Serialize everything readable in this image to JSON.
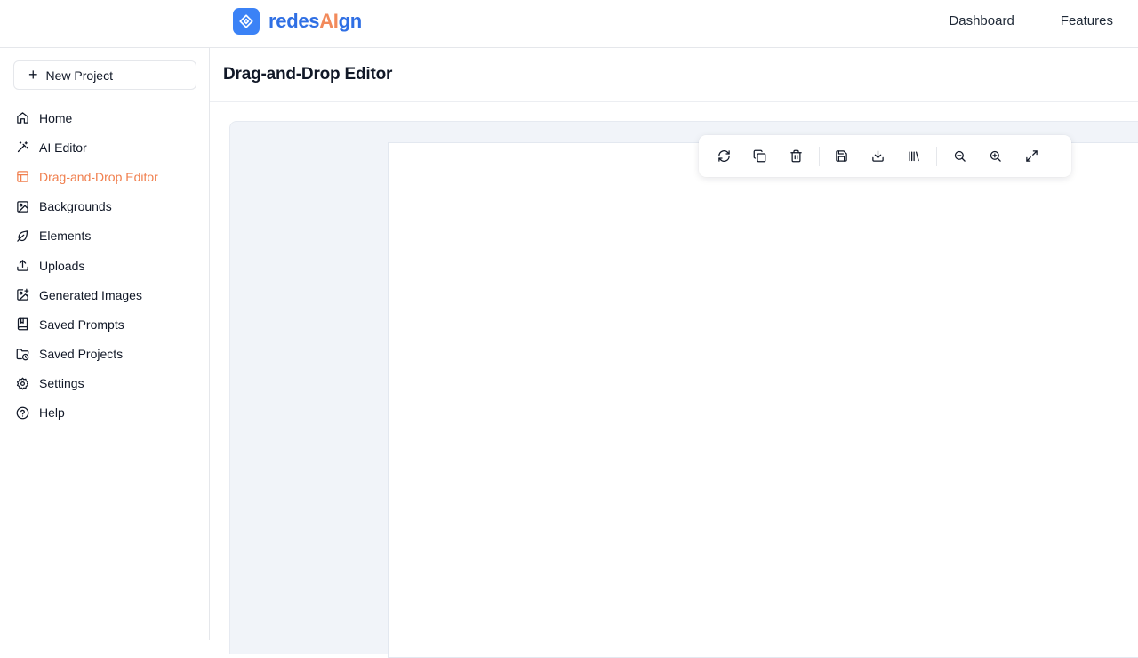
{
  "brand": {
    "name_part1": "redes",
    "name_part2": "AI",
    "name_part3": "gn",
    "logo_icon": "logo-mark-icon",
    "color": "#3b82f6",
    "accent": "#f28a5b"
  },
  "topnav": [
    {
      "label": "Dashboard"
    },
    {
      "label": "Features"
    }
  ],
  "sidebar": {
    "new_project_label": "New Project",
    "items": [
      {
        "label": "Home",
        "icon": "home-icon"
      },
      {
        "label": "AI Editor",
        "icon": "magic-wand-icon"
      },
      {
        "label": "Drag-and-Drop Editor",
        "icon": "layout-icon",
        "active": true
      },
      {
        "label": "Backgrounds",
        "icon": "image-icon"
      },
      {
        "label": "Elements",
        "icon": "leaf-icon"
      },
      {
        "label": "Uploads",
        "icon": "upload-icon"
      },
      {
        "label": "Generated Images",
        "icon": "image-plus-icon"
      },
      {
        "label": "Saved Prompts",
        "icon": "book-icon"
      },
      {
        "label": "Saved Projects",
        "icon": "folder-clock-icon"
      },
      {
        "label": "Settings",
        "icon": "gear-icon"
      },
      {
        "label": "Help",
        "icon": "help-circle-icon"
      }
    ],
    "active_color": "#f07f4e"
  },
  "main": {
    "title": "Drag-and-Drop Editor"
  },
  "toolbar": {
    "groups": [
      [
        "refresh-icon",
        "copy-icon",
        "trash-icon"
      ],
      [
        "save-icon",
        "download-icon",
        "library-icon"
      ],
      [
        "zoom-out-icon",
        "zoom-in-icon",
        "fullscreen-icon"
      ]
    ]
  }
}
